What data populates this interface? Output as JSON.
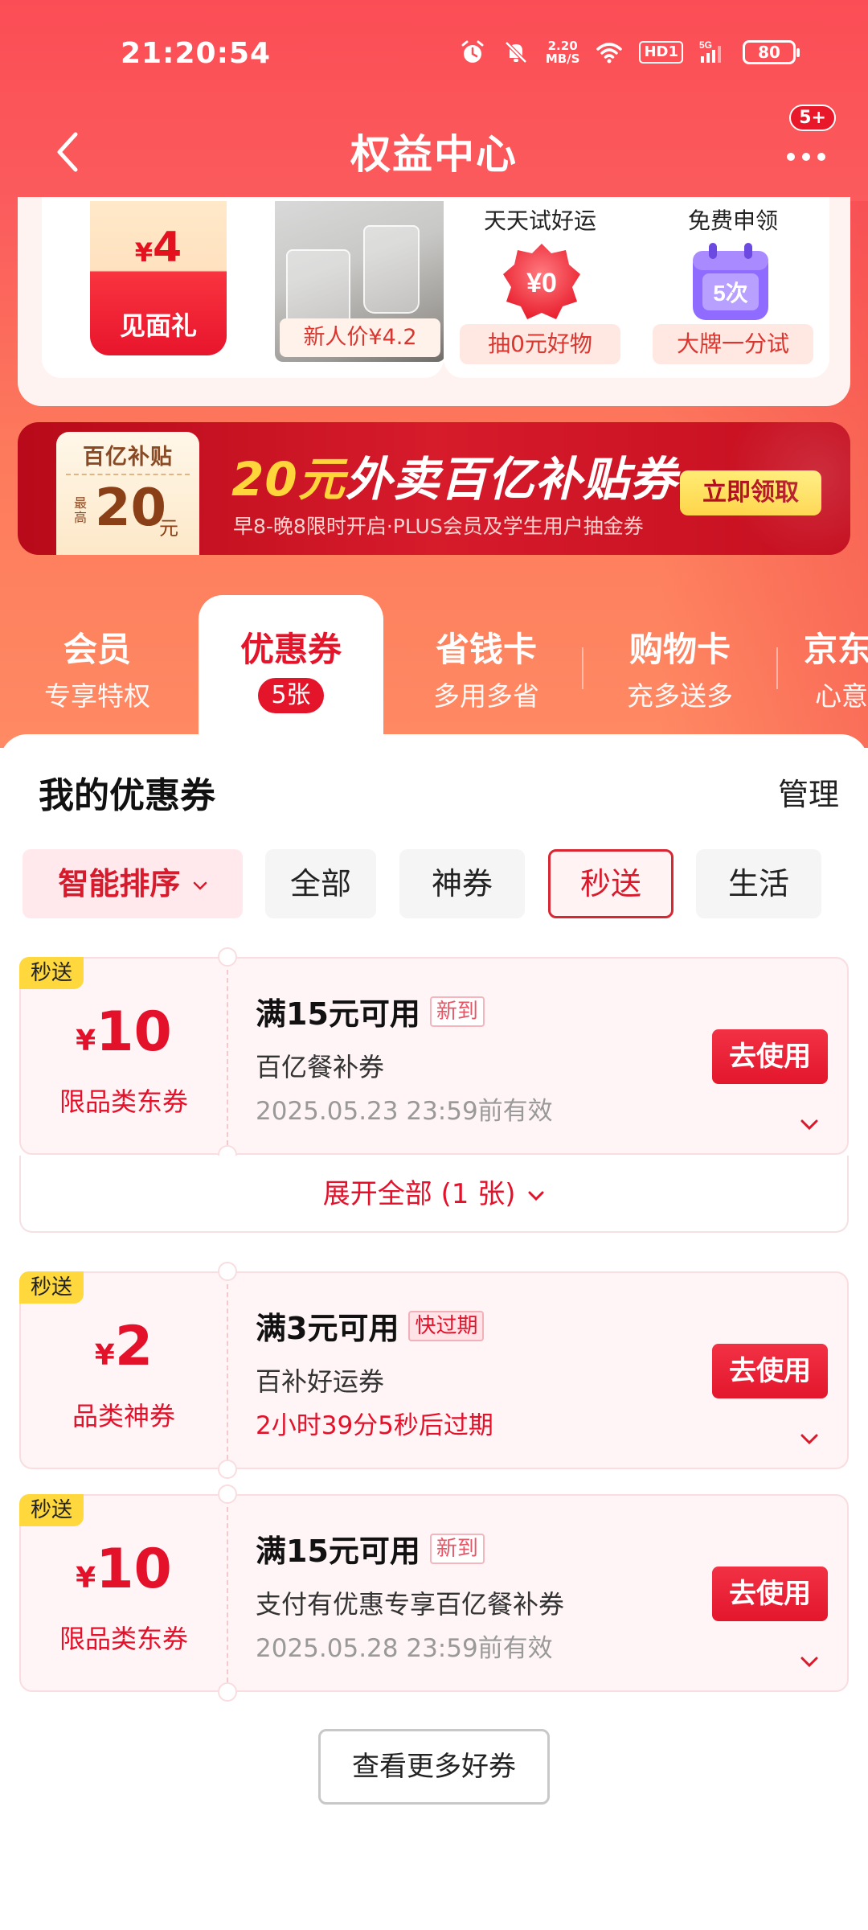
{
  "status_bar": {
    "time": "21:20:54",
    "net_speed": [
      "2.20",
      "MB/S"
    ],
    "hd_label": "HD1",
    "signal_label": "5G",
    "battery": "80"
  },
  "header": {
    "title": "权益中心",
    "notification_count": "5+"
  },
  "benefits": {
    "gift": {
      "currency": "¥",
      "amount": "4",
      "label": "见面礼"
    },
    "new_user_price": "新人价¥4.2",
    "daily_luck": {
      "title": "天天试好运",
      "icon_text": "¥0",
      "button": "抽0元好物"
    },
    "free_trial": {
      "title": "免费申领",
      "icon_text": "5次",
      "button": "大牌一分试"
    }
  },
  "banner": {
    "tag_top": "百亿补贴",
    "tag_most": "最高",
    "tag_amount": "20",
    "tag_unit": "元",
    "title_highlight": "20元",
    "title_rest": "外卖百亿补贴券",
    "subtitle": "早8-晚8限时开启·PLUS会员及学生用户抽金券",
    "button": "立即领取"
  },
  "tabs": [
    {
      "title": "会员",
      "sub": "专享特权"
    },
    {
      "title": "优惠券",
      "badge": "5张"
    },
    {
      "title": "省钱卡",
      "sub": "多用多省"
    },
    {
      "title": "购物卡",
      "sub": "充多送多"
    },
    {
      "title": "京东",
      "sub": "心意"
    }
  ],
  "coupons_section": {
    "title": "我的优惠券",
    "manage": "管理",
    "filters": [
      "智能排序",
      "全部",
      "神券",
      "秒送",
      "生活"
    ],
    "expand_all": "展开全部 (1 张)",
    "more_button": "查看更多好券"
  },
  "coupons": [
    {
      "tag": "秒送",
      "currency": "¥",
      "amount": "10",
      "kind": "限品类东券",
      "condition": "满15元可用",
      "flag": "新到",
      "name": "百亿餐补券",
      "expiry": "2025.05.23 23:59前有效",
      "action": "去使用"
    },
    {
      "tag": "秒送",
      "currency": "¥",
      "amount": "2",
      "kind": "品类神券",
      "condition": "满3元可用",
      "flag": "快过期",
      "name": "百补好运券",
      "expiry": "2小时39分5秒后过期",
      "action": "去使用"
    },
    {
      "tag": "秒送",
      "currency": "¥",
      "amount": "10",
      "kind": "限品类东券",
      "condition": "满15元可用",
      "flag": "新到",
      "name": "支付有优惠专享百亿餐补券",
      "expiry": "2025.05.28 23:59前有效",
      "action": "去使用"
    }
  ],
  "colors": {
    "brand_red": "#e4142a",
    "header_red": "#fb4d55",
    "badge_yellow": "#ffd83d"
  }
}
